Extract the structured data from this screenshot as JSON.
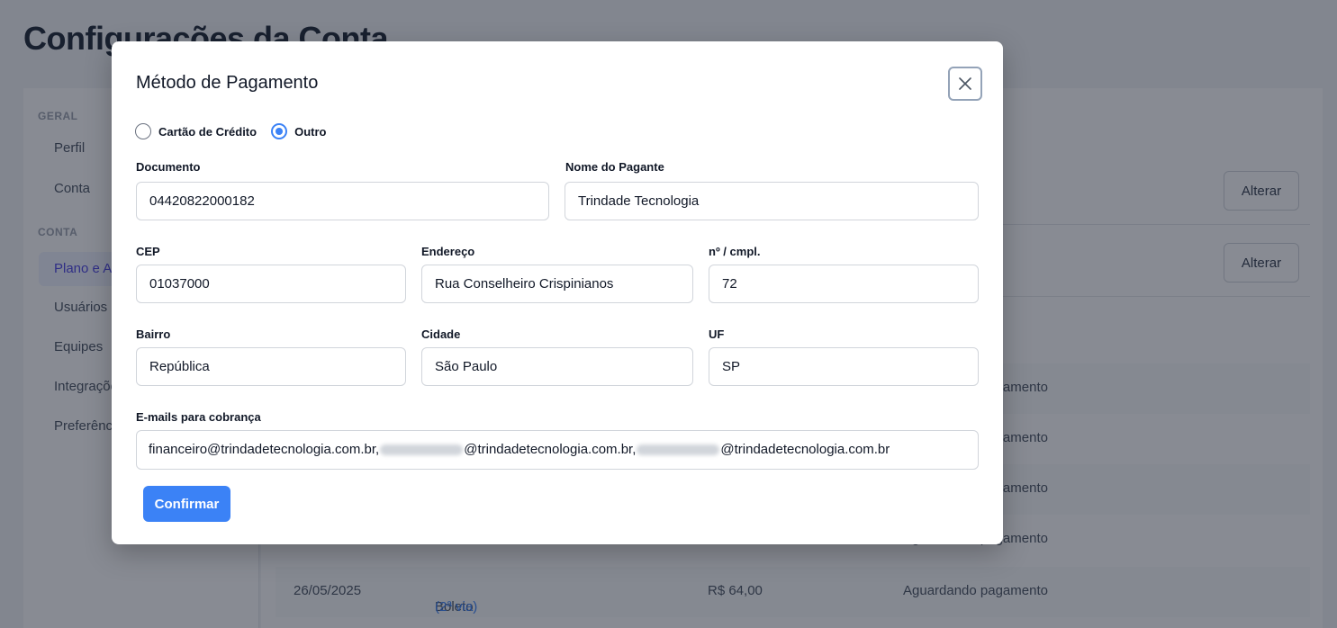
{
  "page": {
    "title": "Configurações da Conta"
  },
  "sidebar": {
    "sections": [
      {
        "title": "GERAL",
        "items": [
          "Perfil",
          "Conta"
        ]
      },
      {
        "title": "CONTA",
        "items": [
          "Plano e Assinatura",
          "Usuários",
          "Equipes",
          "Integrações",
          "Preferências"
        ]
      }
    ],
    "active_item": "Plano e Assinatura"
  },
  "main": {
    "alter_label": "Alterar",
    "invoices": [
      {
        "date": "",
        "method": "",
        "link": "",
        "amount": "",
        "status": "Aguardando pagamento"
      },
      {
        "date": "",
        "method": "",
        "link": "",
        "amount": "",
        "status": "Aguardando pagamento"
      },
      {
        "date": "",
        "method": "",
        "link": "",
        "amount": "",
        "status": "Aguardando pagamento"
      },
      {
        "date": "",
        "method": "",
        "link": "",
        "amount": "",
        "status": "Aguardando pagamento"
      },
      {
        "date": "26/05/2025",
        "method": "Boleto",
        "link": "(2ª via)",
        "amount": "R$ 64,00",
        "status": "Aguardando pagamento"
      }
    ]
  },
  "modal": {
    "title": "Método de Pagamento",
    "close_icon": "close-icon",
    "payment_options": [
      {
        "label": "Cartão de Crédito",
        "checked": false
      },
      {
        "label": "Outro",
        "checked": true
      }
    ],
    "fields": {
      "documento": {
        "label": "Documento",
        "value": "04420822000182"
      },
      "nome_pagante": {
        "label": "Nome do Pagante",
        "value": "Trindade Tecnologia"
      },
      "cep": {
        "label": "CEP",
        "value": "01037000"
      },
      "endereco": {
        "label": "Endereço",
        "value": "Rua Conselheiro Crispinianos"
      },
      "numero": {
        "label": "nº / cmpl.",
        "value": "72"
      },
      "bairro": {
        "label": "Bairro",
        "value": "República"
      },
      "cidade": {
        "label": "Cidade",
        "value": "São Paulo"
      },
      "uf": {
        "label": "UF",
        "value": "SP"
      }
    },
    "emails": {
      "label": "E-mails para cobrança",
      "part1": "financeiro@trindadetecnologia.com.br,",
      "part2": "@trindadetecnologia.com.br,",
      "part3": "@trindadetecnologia.com.br"
    },
    "confirm_label": "Confirmar"
  },
  "colors": {
    "accent": "#3b82f6",
    "overlay": "rgba(17,24,39,0.5)"
  }
}
